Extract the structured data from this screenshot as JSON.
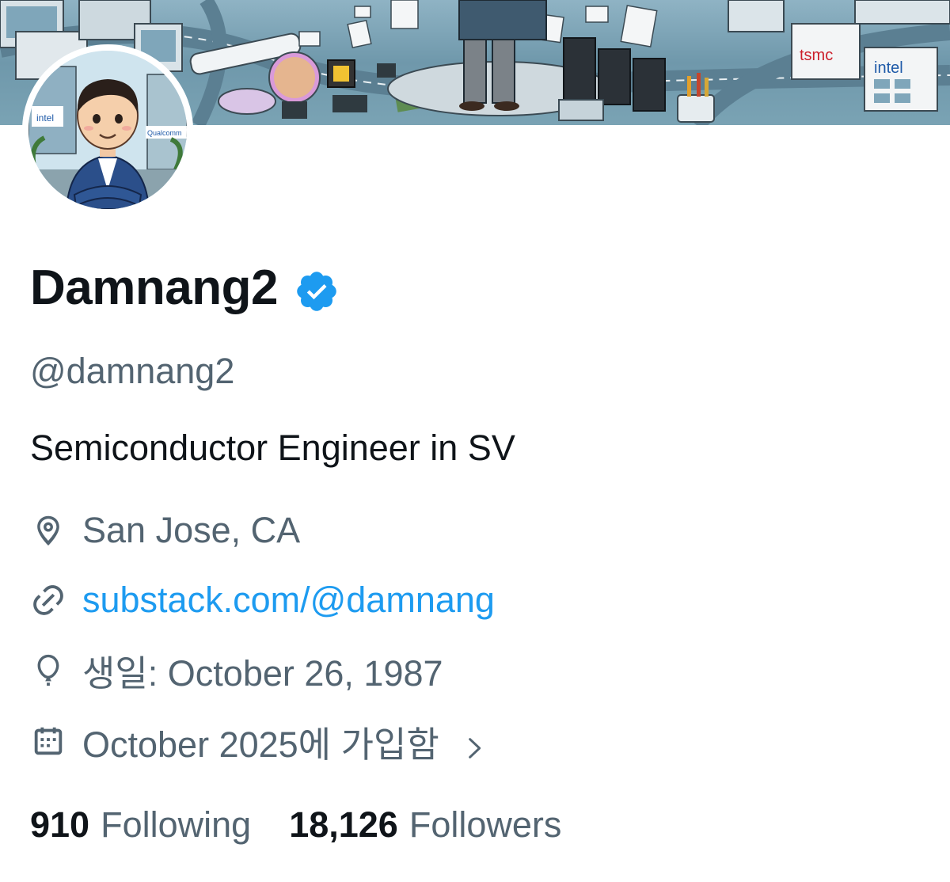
{
  "profile": {
    "display_name": "Damnang2",
    "handle": "@damnang2",
    "bio": "Semiconductor Engineer in SV",
    "location": "San Jose, CA",
    "website": "substack.com/@damnang",
    "birthday": "생일: October 26, 1987",
    "joined": "October 2025에 가입함",
    "verified": true,
    "verified_color": "#1d9bf0"
  },
  "banner": {
    "logo_tsmc": "tsmc",
    "logo_intel": "intel"
  },
  "avatar": {
    "building_sign_intel": "intel",
    "building_sign_qualcomm": "Qualcomm"
  },
  "stats": {
    "following_count": "910",
    "following_label": "Following",
    "followers_count": "18,126",
    "followers_label": "Followers"
  },
  "icons": {
    "location": "location-pin-icon",
    "website": "link-icon",
    "birthday": "balloon-icon",
    "joined": "calendar-icon",
    "joined_more": "chevron-right-icon",
    "verified": "verified-badge-icon"
  },
  "colors": {
    "text_primary": "#0f1419",
    "text_secondary": "#536471",
    "link": "#1d9bf0"
  }
}
